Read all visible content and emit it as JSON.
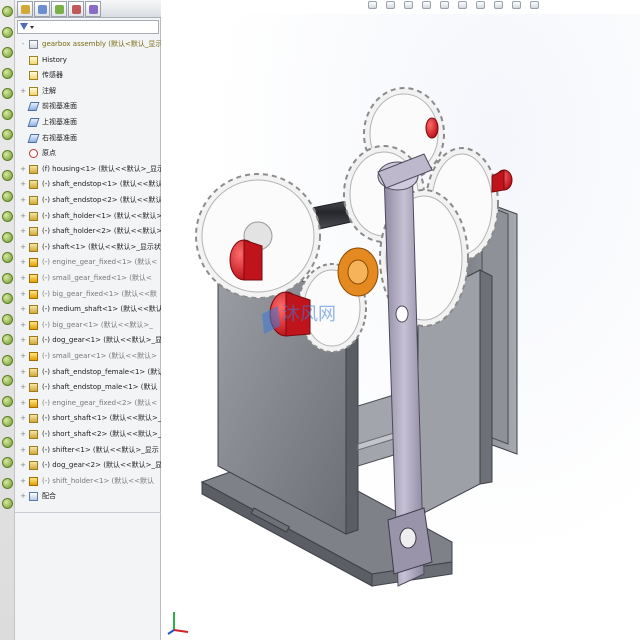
{
  "left_strip": {
    "icons": [
      "tool-icon",
      "tool-icon",
      "tool-icon",
      "tool-icon",
      "tool-icon",
      "tool-icon",
      "tool-icon",
      "tool-icon",
      "tool-icon",
      "tool-icon",
      "tool-icon",
      "tool-icon",
      "tool-icon",
      "tool-icon",
      "tool-icon",
      "tool-icon",
      "tool-icon",
      "tool-icon",
      "tool-icon",
      "tool-icon",
      "tool-icon",
      "tool-icon",
      "tool-icon",
      "tool-icon",
      "tool-icon"
    ]
  },
  "panel": {
    "tabs": [
      "feature-manager-icon",
      "property-manager-icon",
      "configuration-manager-icon",
      "dimxpert-icon",
      "display-manager-icon"
    ],
    "filter_icon": "filter-icon"
  },
  "tree": {
    "items": [
      {
        "label": "gearbox assembly  (默认<默认_显示",
        "icon": "assembly",
        "expand": "-",
        "style": "top"
      },
      {
        "label": "History",
        "icon": "note",
        "expand": "",
        "style": ""
      },
      {
        "label": "传感器",
        "icon": "note",
        "expand": "",
        "style": ""
      },
      {
        "label": "注解",
        "icon": "note",
        "expand": "+",
        "style": ""
      },
      {
        "label": "前视基准面",
        "icon": "plane",
        "expand": "",
        "style": ""
      },
      {
        "label": "上视基准面",
        "icon": "plane",
        "expand": "",
        "style": ""
      },
      {
        "label": "右视基准面",
        "icon": "plane",
        "expand": "",
        "style": ""
      },
      {
        "label": "原点",
        "icon": "origin",
        "expand": "",
        "style": ""
      },
      {
        "label": "(f) housing<1> (默认<<默认>_显示",
        "icon": "part",
        "expand": "+",
        "style": ""
      },
      {
        "label": "(-) shaft_endstop<1> (默认<<默认>",
        "icon": "part",
        "expand": "+",
        "style": ""
      },
      {
        "label": "(-) shaft_endstop<2> (默认<<默认>",
        "icon": "part",
        "expand": "+",
        "style": ""
      },
      {
        "label": "(-) shaft_holder<1> (默认<<默认>_",
        "icon": "part",
        "expand": "+",
        "style": ""
      },
      {
        "label": "(-) shaft_holder<2> (默认<<默认>_",
        "icon": "part",
        "expand": "+",
        "style": ""
      },
      {
        "label": "(-) shaft<1> (默认<<默认>_显示状态",
        "icon": "part",
        "expand": "+",
        "style": ""
      },
      {
        "label": "(-) engine_gear_fixed<1> (默认<",
        "icon": "warn",
        "expand": "+",
        "style": "dim"
      },
      {
        "label": "(-) small_gear_fixed<1> (默认<",
        "icon": "warn",
        "expand": "+",
        "style": "dim"
      },
      {
        "label": "(-) big_gear_fixed<1> (默认<<默",
        "icon": "warn",
        "expand": "+",
        "style": "dim"
      },
      {
        "label": "(-) medium_shaft<1> (默认<<默认",
        "icon": "part",
        "expand": "+",
        "style": ""
      },
      {
        "label": "(-) big_gear<1> (默认<<默认>_",
        "icon": "warn",
        "expand": "+",
        "style": "dim"
      },
      {
        "label": "(-) dog_gear<1> (默认<<默认>_显示",
        "icon": "part",
        "expand": "+",
        "style": ""
      },
      {
        "label": "(-) small_gear<1> (默认<<默认>",
        "icon": "warn",
        "expand": "+",
        "style": "dim"
      },
      {
        "label": "(-) shaft_endstop_female<1> (默认",
        "icon": "part",
        "expand": "+",
        "style": ""
      },
      {
        "label": "(-) shaft_endstop_male<1> (默认",
        "icon": "part",
        "expand": "+",
        "style": ""
      },
      {
        "label": "(-) engine_gear_fixed<2> (默认<",
        "icon": "warn",
        "expand": "+",
        "style": "dim"
      },
      {
        "label": "(-) short_shaft<1> (默认<<默认>_",
        "icon": "part",
        "expand": "+",
        "style": ""
      },
      {
        "label": "(-) short_shaft<2> (默认<<默认>_",
        "icon": "part",
        "expand": "+",
        "style": ""
      },
      {
        "label": "(-) shifter<1> (默认<<默认>_显示",
        "icon": "part",
        "expand": "+",
        "style": ""
      },
      {
        "label": "(-) dog_gear<2> (默认<<默认>_显示",
        "icon": "part",
        "expand": "+",
        "style": ""
      },
      {
        "label": "(-) shift_holder<1> (默认<<默认",
        "icon": "warn",
        "expand": "+",
        "style": "dim"
      },
      {
        "label": "配合",
        "icon": "mate",
        "expand": "+",
        "style": ""
      }
    ]
  },
  "view_toolbar": {
    "tools": [
      "zoom-to-fit-icon",
      "zoom-area-icon",
      "previous-view-icon",
      "section-view-icon",
      "view-orientation-icon",
      "display-style-icon",
      "hide-show-icon",
      "edit-appearance-icon",
      "apply-scene-icon",
      "view-settings-icon"
    ]
  },
  "viewport": {
    "watermark": "沐风网",
    "colors": {
      "housing": "#8d8f96",
      "housing_dark": "#6e7077",
      "gear": "#f2f2f2",
      "gear_edge": "#9a9a9a",
      "endstop": "#e01b24",
      "shifter": "#a9a3b8",
      "dog_gear": "#e08b1e",
      "shaft": "#3d3f46"
    },
    "triad": "axis-triad-icon"
  }
}
